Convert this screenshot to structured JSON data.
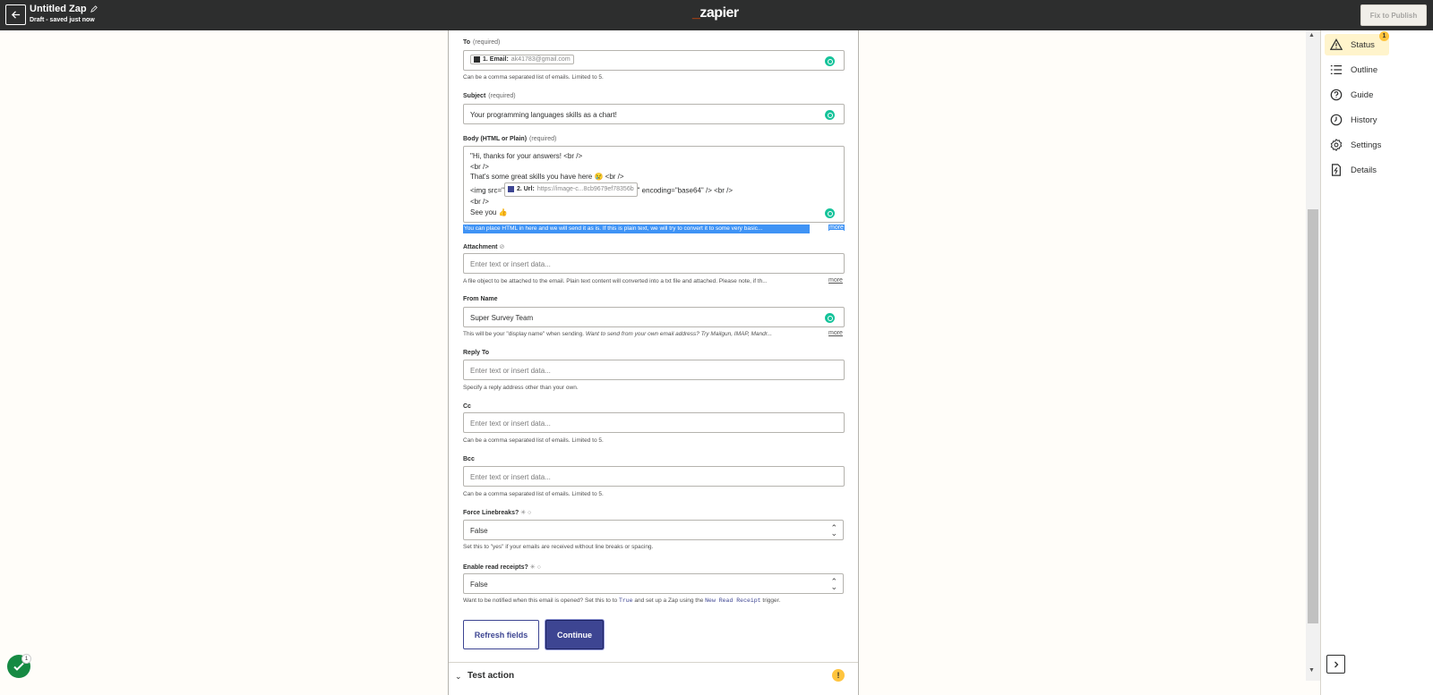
{
  "topbar": {
    "title": "Untitled Zap",
    "status": "Draft - saved just now",
    "logo_dash": "_",
    "logo_text": "zapier",
    "publish_label": "Fix to Publish"
  },
  "form": {
    "to": {
      "label": "To",
      "required": "(required)",
      "pill_label": "1. Email:",
      "pill_value": "ak41783@gmail.com",
      "help": "Can be a comma separated list of emails. Limited to 5."
    },
    "subject": {
      "label": "Subject",
      "required": "(required)",
      "value": "Your programming languages skills as a chart!"
    },
    "body": {
      "label": "Body (HTML or Plain)",
      "required": "(required)",
      "line1": "\"Hi, thanks for your answers! <br />",
      "line2": "<br />",
      "line3": "That's some great skills you have here 😢 <br />",
      "line4_pre": "<img src=\"",
      "pill_label": "2. Url:",
      "pill_value": "https://image-c...8cb9679ef78356b",
      "line4_post": "\" encoding=\"base64\" /> <br />",
      "line5": "<br />",
      "line6": "See you 👍",
      "help": "You can place HTML in here and we will send it as is. If this is plain text, we will try to convert it to some very basic...",
      "more": "more"
    },
    "attachment": {
      "label": "Attachment",
      "mini": "⊘",
      "placeholder": "Enter text or insert data...",
      "help": "A file object to be attached to the email. Plain text content will converted into a txt file and attached. Please note, if th...",
      "more": "more"
    },
    "from_name": {
      "label": "From Name",
      "value": "Super Survey Team",
      "help_plain": "This will be your \"display name\" when sending.",
      "help_italic": "Want to send from your own email address? Try Mailgun, IMAP, Mandr...",
      "more": "more"
    },
    "reply_to": {
      "label": "Reply To",
      "placeholder": "Enter text or insert data...",
      "help": "Specify a reply address other than your own."
    },
    "cc": {
      "label": "Cc",
      "placeholder": "Enter text or insert data...",
      "help": "Can be a comma separated list of emails. Limited to 5."
    },
    "bcc": {
      "label": "Bcc",
      "placeholder": "Enter text or insert data...",
      "help": "Can be a comma separated list of emails. Limited to 5."
    },
    "force_linebreaks": {
      "label": "Force Linebreaks?",
      "mini": "✳ ○",
      "value": "False",
      "help": "Set this to \"yes\" if your emails are received without line breaks or spacing."
    },
    "read_receipts": {
      "label": "Enable read receipts?",
      "mini": "✳ ○",
      "value": "False",
      "help_pre": "Want to be notified when this email is opened? Set this to to",
      "help_code1": "True",
      "help_mid": "and set up a Zap using the",
      "help_code2": "New Read Receipt",
      "help_post": "trigger."
    },
    "refresh_label": "Refresh fields",
    "continue_label": "Continue",
    "test_action_label": "Test action",
    "test_warn": "!"
  },
  "sidebar": {
    "badge": "1",
    "items": [
      {
        "label": "Status",
        "icon": "warning-icon"
      },
      {
        "label": "Outline",
        "icon": "list-icon"
      },
      {
        "label": "Guide",
        "icon": "help-icon"
      },
      {
        "label": "History",
        "icon": "clock-icon"
      },
      {
        "label": "Settings",
        "icon": "gear-icon"
      },
      {
        "label": "Details",
        "icon": "file-bolt-icon"
      }
    ]
  },
  "check_count": "1",
  "colors": {
    "topbar": "#2d2e2e",
    "brand_orange": "#ff4f00",
    "primary": "#3d4592",
    "warning": "#ffc43e",
    "grammarly": "#15c39a",
    "selection": "#3f93f5"
  }
}
